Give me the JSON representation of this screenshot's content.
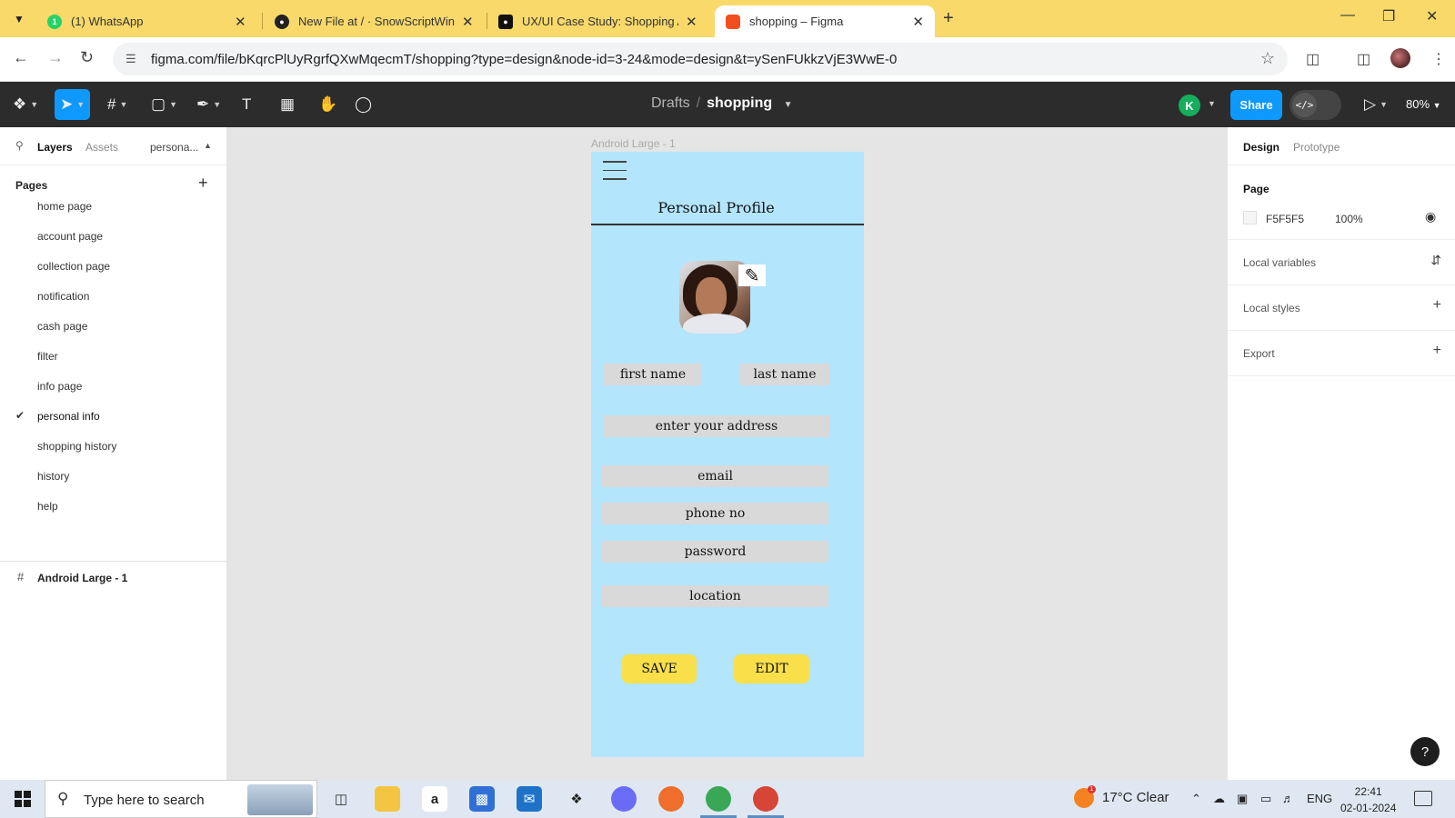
{
  "browser": {
    "tabs": [
      {
        "title": "(1) WhatsApp",
        "icon": "whatsapp-icon",
        "active": false
      },
      {
        "title": "New File at / · SnowScriptWinte",
        "icon": "github-icon",
        "active": false
      },
      {
        "title": "UX/UI Case Study: Shopping Ap",
        "icon": "medium-icon",
        "active": false
      },
      {
        "title": "shopping – Figma",
        "icon": "figma-icon",
        "active": true
      }
    ],
    "url": "figma.com/file/bKqrcPlUyRgrfQXwMqecmT/shopping?type=design&node-id=3-24&mode=design&t=ySenFUkkzVjE3WwE-0"
  },
  "figma": {
    "breadcrumb": {
      "drafts": "Drafts",
      "file": "shopping"
    },
    "avatar_initial": "K",
    "share_label": "Share",
    "dev_mode_label": "</>",
    "zoom": "80%",
    "left_panel": {
      "tabs": {
        "layers": "Layers",
        "assets": "Assets",
        "page_select": "persona..."
      },
      "pages_heading": "Pages",
      "pages": [
        "home page",
        "account page",
        "collection page",
        "notification",
        "cash page",
        "filter",
        "info page",
        "personal info",
        "shopping history",
        "history",
        "help"
      ],
      "current_page_index": 7,
      "layer": "Android Large - 1"
    },
    "right_panel": {
      "tabs": {
        "design": "Design",
        "prototype": "Prototype"
      },
      "page_heading": "Page",
      "page_color": "F5F5F5",
      "page_opacity": "100%",
      "local_variables": "Local variables",
      "local_styles": "Local styles",
      "export": "Export"
    },
    "help_label": "?"
  },
  "frame": {
    "label": "Android Large - 1",
    "title": "Personal Profile",
    "fields": {
      "first_name": "first name",
      "last_name": "last name",
      "address": "enter your address",
      "email": "email",
      "phone": "phone no",
      "password": "password",
      "location": "location"
    },
    "buttons": {
      "save": "SAVE",
      "edit": "EDIT"
    },
    "colors": {
      "background": "#b3e5fc",
      "field": "#d9d9d9",
      "button": "#f9e04b"
    }
  },
  "taskbar": {
    "search_placeholder": "Type here to search",
    "weather": "17°C  Clear",
    "language": "ENG",
    "time": "22:41",
    "date": "02-01-2024"
  }
}
